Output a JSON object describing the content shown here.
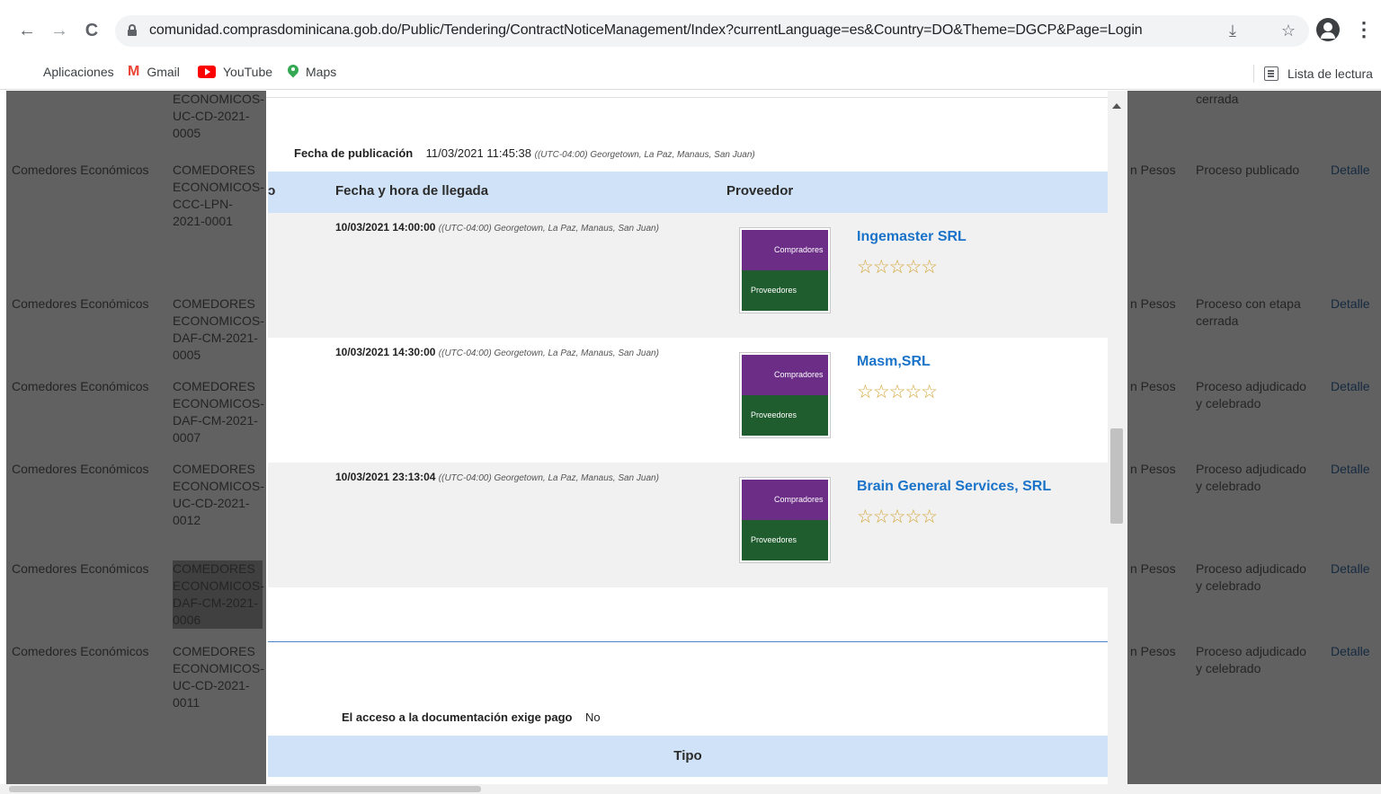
{
  "browser": {
    "url": "comunidad.comprasdominicana.gob.do/Public/Tendering/ContractNoticeManagement/Index?currentLanguage=es&Country=DO&Theme=DGCP&Page=Login",
    "back_icon": "←",
    "forward_icon": "→",
    "reload_icon": "C",
    "download_icon": "⤓",
    "star_icon": "☆",
    "menu_icon": "⋮",
    "bookmarks": [
      {
        "label": "Aplicaciones"
      },
      {
        "label": "Gmail"
      },
      {
        "label": "YouTube"
      },
      {
        "label": "Maps"
      }
    ],
    "reading_list": "Lista de lectura"
  },
  "background_rows": [
    {
      "org": "",
      "code": "ECONOMICOS-\nUC-CD-2021-\n0005",
      "currency": "",
      "status": "cerrada",
      "link": ""
    },
    {
      "org": "Comedores Económicos",
      "code": "COMEDORES\nECONOMICOS-\nCCC-LPN-\n2021-0001",
      "currency": "n Pesos",
      "status": "Proceso publicado",
      "link": "Detalle"
    },
    {
      "org": "Comedores Económicos",
      "code": "COMEDORES\nECONOMICOS-\nDAF-CM-2021-\n0005",
      "currency": "n Pesos",
      "status": "Proceso con etapa\ncerrada",
      "link": "Detalle"
    },
    {
      "org": "Comedores Económicos",
      "code": "COMEDORES\nECONOMICOS-\nDAF-CM-2021-\n0007",
      "currency": "n Pesos",
      "status": "Proceso adjudicado\ny celebrado",
      "link": "Detalle"
    },
    {
      "org": "Comedores Económicos",
      "code": "COMEDORES\nECONOMICOS-\nUC-CD-2021-\n0012",
      "currency": "n Pesos",
      "status": "Proceso adjudicado\ny celebrado",
      "link": "Detalle"
    },
    {
      "org": "Comedores Económicos",
      "code": "COMEDORES\nECONOMICOS-\nDAF-CM-2021-\n0006",
      "currency": "n Pesos",
      "status": "Proceso adjudicado\ny celebrado",
      "link": "Detalle"
    },
    {
      "org": "Comedores Económicos",
      "code": "COMEDORES\nECONOMICOS-\nUC-CD-2021-\n0011",
      "currency": "n Pesos",
      "status": "Proceso adjudicado\ny celebrado",
      "link": "Detalle"
    }
  ],
  "modal": {
    "pub_label": "Fecha de publicación",
    "pub_value": "11/03/2021 11:45:38",
    "pub_tz": "((UTC-04:00) Georgetown, La Paz, Manaus, San Juan)",
    "col_arrival": "Fecha y hora de llegada",
    "col_supplier": "Proveedor",
    "logo_top": "Compradores",
    "logo_bottom": "Proveedores",
    "stars": "☆☆☆☆☆",
    "offers": [
      {
        "datetime": "10/03/2021 14:00:00",
        "tz": "((UTC-04:00) Georgetown, La Paz, Manaus, San Juan)",
        "supplier": "Ingemaster SRL"
      },
      {
        "datetime": "10/03/2021 14:30:00",
        "tz": "((UTC-04:00) Georgetown, La Paz, Manaus, San Juan)",
        "supplier": "Masm,SRL"
      },
      {
        "datetime": "10/03/2021 23:13:04",
        "tz": "((UTC-04:00) Georgetown, La Paz, Manaus, San Juan)",
        "supplier": "Brain General Services, SRL"
      }
    ],
    "access_label": "El acceso a la documentación exige pago",
    "access_value": "No",
    "tipo_label": "Tipo"
  }
}
